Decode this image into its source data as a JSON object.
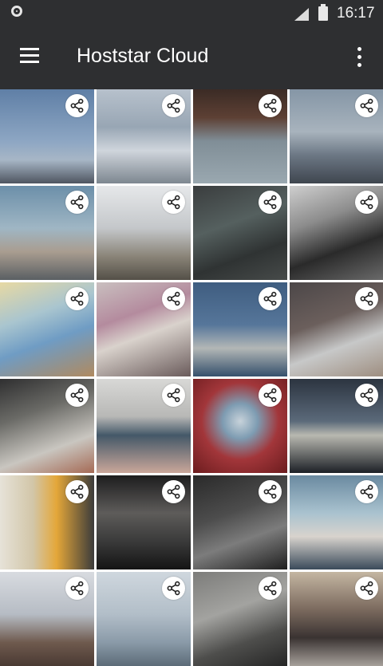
{
  "status_bar": {
    "time": "16:17"
  },
  "toolbar": {
    "title": "Hoststar Cloud"
  },
  "icons": {
    "menu": "menu-icon",
    "overflow": "more-vert-icon",
    "share": "share-icon",
    "status": [
      "notification-circle-icon",
      "signal-icon",
      "battery-icon"
    ]
  },
  "grid": {
    "columns": 4,
    "tiles": [
      {
        "name": "photo-coast-sky",
        "bg": "linear-gradient(180deg,#5f7fa6 0%,#8da6c3 55%,#a7b6c6 75%,#4e5560 100%)"
      },
      {
        "name": "photo-woman-city-view",
        "bg": "linear-gradient(180deg,#b7c1cc 0%,#98a6b4 40%,#cfd5dc 65%,#7d8790 100%)"
      },
      {
        "name": "photo-man-phone-hoodie",
        "bg": "linear-gradient(180deg,#3b2b25 0%,#5d4034 30%,#808e97 55%,#9aa8b0 100%)"
      },
      {
        "name": "photo-city-window",
        "bg": "linear-gradient(180deg,#8596a6 0%,#a8b3bd 45%,#6c7784 70%,#3f464f 100%)"
      },
      {
        "name": "photo-woman-skyline",
        "bg": "linear-gradient(180deg,#6c8fa9 0%,#9fb6c4 45%,#a99d90 70%,#5a5f63 100%)"
      },
      {
        "name": "photo-legs-fence",
        "bg": "linear-gradient(180deg,#e6e8ea 0%,#c4c7ca 45%,#8a8478 75%,#545048 100%)"
      },
      {
        "name": "photo-person-sofa",
        "bg": "linear-gradient(160deg,#3a3d3e 0%,#55605f 40%,#2f3333 70%,#474b4a 100%)"
      },
      {
        "name": "photo-washing-machine",
        "bg": "linear-gradient(160deg,#cfcfcf 0%,#8c8c8c 35%,#2a2a2a 65%,#6a6a6a 100%)"
      },
      {
        "name": "photo-colorful-smoke",
        "bg": "linear-gradient(160deg,#e7d9a3 0%,#a9c5cf 35%,#6f9cc4 60%,#b08a5f 100%)"
      },
      {
        "name": "photo-hearts-stairs",
        "bg": "linear-gradient(160deg,#c9bfbf 0%,#b48b9e 35%,#d9d2cc 55%,#6a5b5b 100%)"
      },
      {
        "name": "photo-wood-lifebuoy",
        "bg": "linear-gradient(180deg,#3f5d80 0%,#56769a 45%,#b3b7b6 70%,#35506c 100%)"
      },
      {
        "name": "photo-laptop-brick",
        "bg": "linear-gradient(160deg,#4c4748 0%,#6b5f5c 40%,#c7c8c8 65%,#9e8e80 100%)"
      },
      {
        "name": "photo-street-walker",
        "bg": "linear-gradient(160deg,#2f2f30 0%,#6a6a66 35%,#c9c6c0 70%,#a56a55 100%)"
      },
      {
        "name": "photo-hands-gift",
        "bg": "linear-gradient(180deg,#d8d8d6 0%,#b8b8b6 40%,#445868 60%,#caa79a 100%)"
      },
      {
        "name": "photo-red-smoke",
        "bg": "radial-gradient(circle at 50% 45%,#c7d2da 0%,#7e9cb2 25%,#a2363a 55%,#6b1c1e 100%)"
      },
      {
        "name": "photo-building-night",
        "bg": "linear-gradient(180deg,#2c3440 0%,#5b6a7a 45%,#b8b8b0 60%,#1c2026 100%)"
      },
      {
        "name": "photo-girl-doorway",
        "bg": "linear-gradient(90deg,#e6e2d8 0%,#d2c6a8 35%,#e4a739 60%,#3b3b3b 100%)"
      },
      {
        "name": "photo-dj-turntable",
        "bg": "linear-gradient(180deg,#1d1d1e 0%,#5e5c5a 40%,#3a3a3a 70%,#141414 100%)"
      },
      {
        "name": "photo-hand-phone",
        "bg": "linear-gradient(160deg,#2a2a2a 0%,#4d4d4d 40%,#7c7c7c 65%,#1f1f1f 100%)"
      },
      {
        "name": "photo-woman-sunglasses",
        "bg": "linear-gradient(180deg,#6a8aa0 0%,#a9c2cf 40%,#d8d3cd 65%,#3a4a5a 100%)"
      },
      {
        "name": "photo-girl-reading",
        "bg": "linear-gradient(180deg,#d8dbe0 0%,#b6bcc4 45%,#6f5a4e 75%,#4a3a33 100%)"
      },
      {
        "name": "photo-city-haze",
        "bg": "linear-gradient(180deg,#cfd7de 0%,#b2bec8 45%,#8a9aa8 75%,#5c6b78 100%)"
      },
      {
        "name": "photo-stairs-tablet",
        "bg": "linear-gradient(160deg,#7c7c7a 0%,#a3a3a0 40%,#4e4e4c 70%,#262626 100%)"
      },
      {
        "name": "photo-people-headphones",
        "bg": "linear-gradient(180deg,#c4b6a2 0%,#7b6a5e 40%,#3a3332 70%,#a6a09a 100%)"
      }
    ]
  }
}
